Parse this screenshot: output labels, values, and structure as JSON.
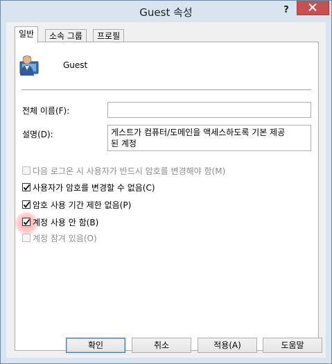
{
  "window": {
    "title": "Guest 속성",
    "help": "?"
  },
  "tabs": [
    {
      "label": "일반",
      "active": true
    },
    {
      "label": "소속 그룹",
      "active": false
    },
    {
      "label": "프로필",
      "active": false
    }
  ],
  "user": {
    "name": "Guest",
    "icon": "user-icon"
  },
  "fields": {
    "full_name_label": "전체 이름(F):",
    "full_name_value": "",
    "description_label": "설명(D):",
    "description_line1": "게스트가 컴퓨터/도메인을 액세스하도록 기본 제공",
    "description_line2": "된 계정"
  },
  "options": [
    {
      "label": "다음 로그온 시 사용자가 반드시 암호를 변경해야 함(M)",
      "checked": false,
      "enabled": false
    },
    {
      "label": "사용자가 암호를 변경할 수 없음(C)",
      "checked": true,
      "enabled": true
    },
    {
      "label": "암호 사용 기간 제한 없음(P)",
      "checked": true,
      "enabled": true
    },
    {
      "label": "계정 사용 안 함(B)",
      "checked": true,
      "enabled": true
    },
    {
      "label": "계정 잠겨 있음(O)",
      "checked": false,
      "enabled": false
    }
  ],
  "buttons": {
    "ok": "확인",
    "cancel": "취소",
    "apply": "적용(A)",
    "help": "도움말"
  },
  "colors": {
    "close": "#c75050",
    "frame": "#d9e4f1",
    "accent": "#3c7fb1"
  }
}
